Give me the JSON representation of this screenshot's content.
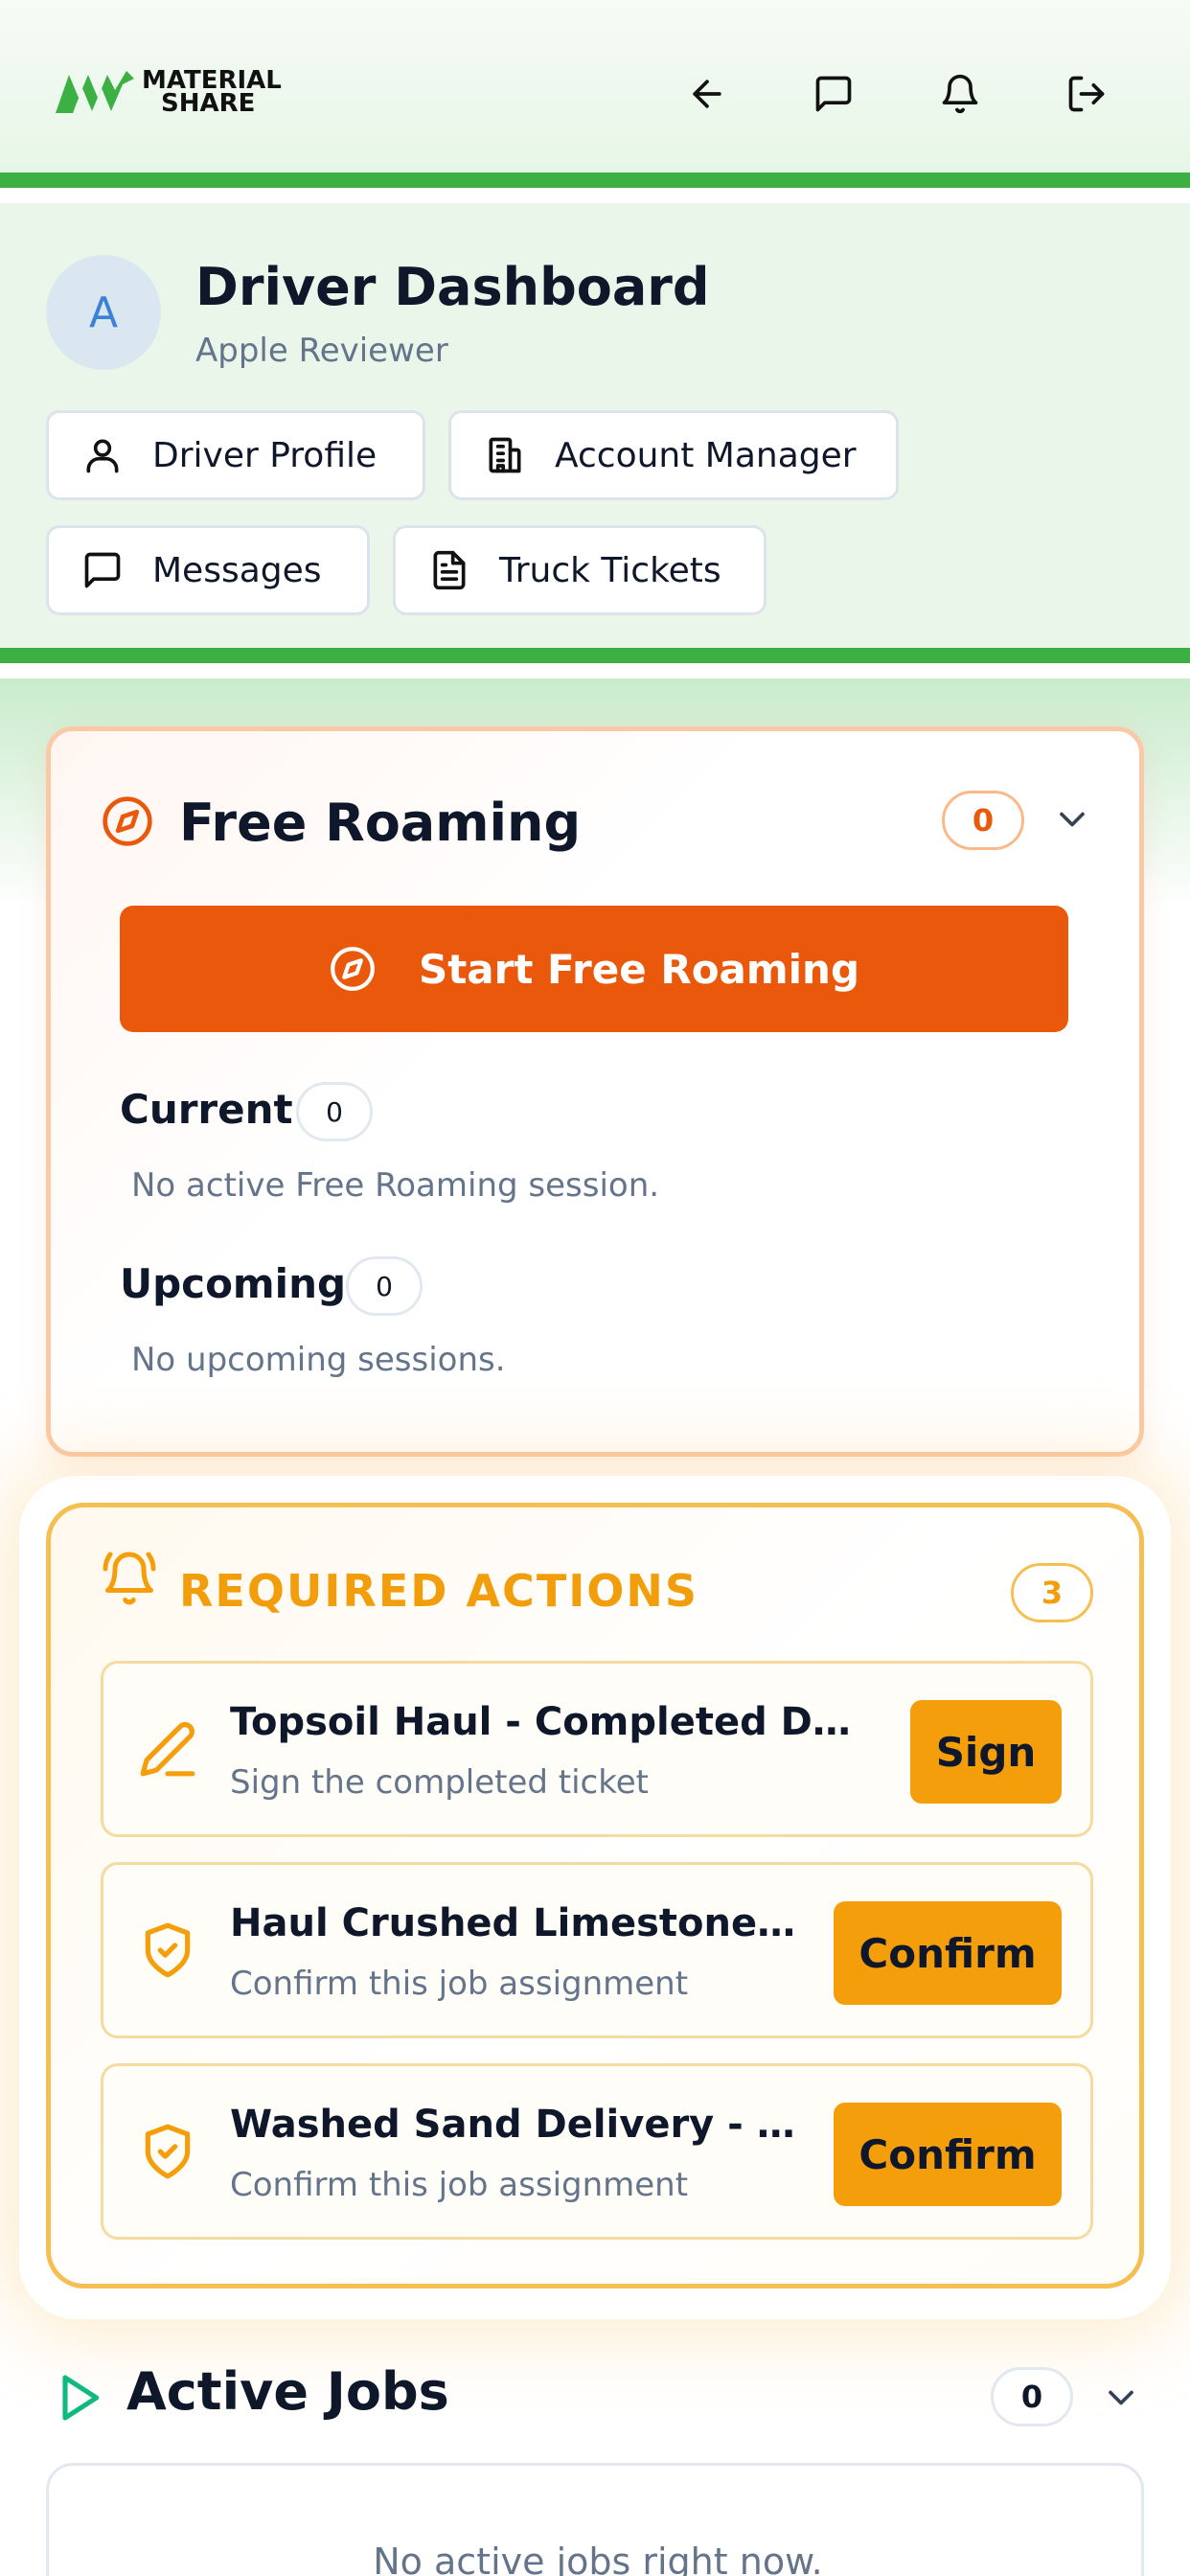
{
  "brand": {
    "logo_line1": "MATERIAL",
    "logo_line2": "SHARE",
    "green": "#3cb043"
  },
  "header": {
    "icons": [
      "arrow-left-icon",
      "message-square-icon",
      "bell-icon",
      "log-out-icon"
    ]
  },
  "driver": {
    "avatar_initial": "A",
    "title": "Driver Dashboard",
    "subtitle": "Apple Reviewer",
    "buttons": [
      {
        "label": "Driver Profile",
        "icon": "user-icon"
      },
      {
        "label": "Account Manager",
        "icon": "building-icon"
      },
      {
        "label": "Messages",
        "icon": "message-square-icon"
      },
      {
        "label": "Truck Tickets",
        "icon": "file-text-icon"
      }
    ]
  },
  "free_roaming": {
    "title": "Free Roaming",
    "count": "0",
    "start_label": "Start Free Roaming",
    "current_label": "Current",
    "current_count": "0",
    "current_empty": "No active Free Roaming session.",
    "upcoming_label": "Upcoming",
    "upcoming_count": "0",
    "upcoming_empty": "No upcoming sessions.",
    "accent": "#ea580c"
  },
  "required_actions": {
    "title": "REQUIRED ACTIONS",
    "count": "3",
    "accent": "#f59e0b",
    "items": [
      {
        "title": "Topsoil Haul - Completed Dem...",
        "subtitle": "Sign the completed ticket",
        "action": "Sign",
        "icon": "pen-icon"
      },
      {
        "title": "Haul Crushed Limestone t...",
        "subtitle": "Confirm this job assignment",
        "action": "Confirm",
        "icon": "shield-check-icon"
      },
      {
        "title": "Washed Sand Delivery - Riv...",
        "subtitle": "Confirm this job assignment",
        "action": "Confirm",
        "icon": "shield-check-icon"
      }
    ]
  },
  "active_jobs": {
    "title": "Active Jobs",
    "count": "0",
    "empty": "No active jobs right now."
  }
}
